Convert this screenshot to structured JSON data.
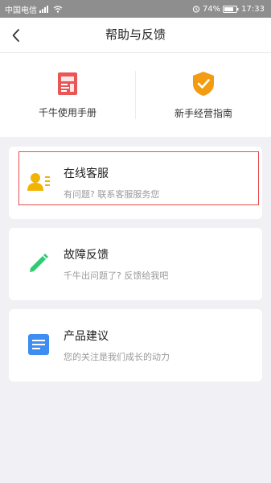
{
  "status_bar": {
    "carrier": "中国电信",
    "battery": "74%",
    "time": "17:33"
  },
  "header": {
    "title": "帮助与反馈"
  },
  "quick_links": [
    {
      "label": "千牛使用手册",
      "icon": "manual-icon"
    },
    {
      "label": "新手经营指南",
      "icon": "guide-shield-icon"
    }
  ],
  "cards": [
    {
      "title": "在线客服",
      "subtitle": "有问题? 联系客服服务您",
      "icon": "customer-service-icon",
      "highlighted": true
    },
    {
      "title": "故障反馈",
      "subtitle": "千牛出问题了? 反馈给我吧",
      "icon": "pencil-icon",
      "highlighted": false
    },
    {
      "title": "产品建议",
      "subtitle": "您的关注是我们成长的动力",
      "icon": "document-icon",
      "highlighted": false
    }
  ],
  "colors": {
    "manual": "#e85656",
    "guide": "#f39c12",
    "customer_service": "#f1b400",
    "feedback": "#2ecc71",
    "suggestion": "#3d8ef0",
    "highlight": "#e84c4c"
  }
}
